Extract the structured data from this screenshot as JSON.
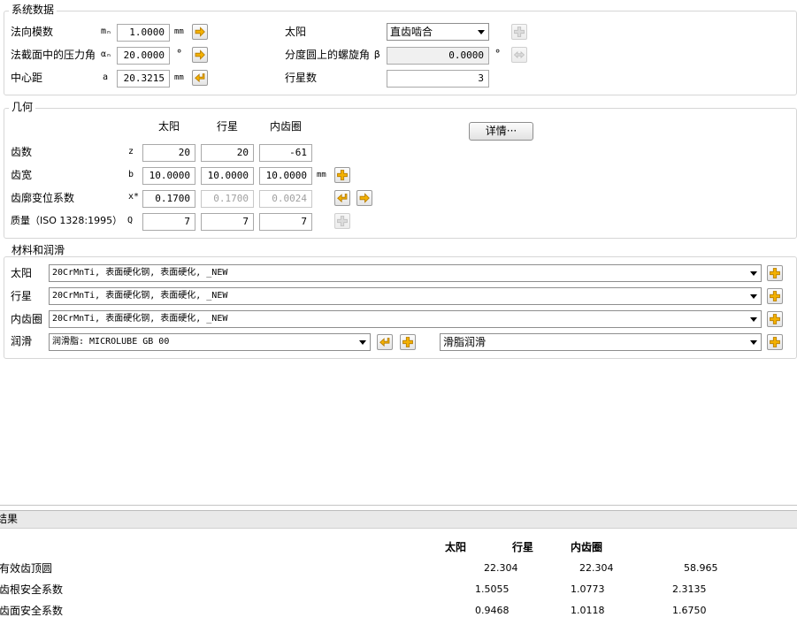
{
  "system": {
    "legend": "系统数据",
    "normal_module": {
      "label": "法向模数",
      "symbol": "mₙ",
      "value": "1.0000",
      "unit": "mm"
    },
    "pressure_angle": {
      "label": "法截面中的压力角",
      "symbol": "αₙ",
      "value": "20.0000",
      "unit": "°"
    },
    "center_distance": {
      "label": "中心距",
      "symbol": "a",
      "value": "20.3215",
      "unit": "mm"
    },
    "sun": {
      "label": "太阳",
      "value": "直齿啮合"
    },
    "helix_angle": {
      "label": "分度圆上的螺旋角",
      "symbol": "β",
      "value": "0.0000",
      "unit": "°"
    },
    "planets": {
      "label": "行星数",
      "value": "3"
    }
  },
  "geometry": {
    "legend": "几何",
    "columns": [
      "太阳",
      "行星",
      "内齿圈"
    ],
    "details_button": "详情···",
    "rows": [
      {
        "label": "齿数",
        "symbol": "z",
        "values": [
          "20",
          "20",
          "-61"
        ],
        "unit": ""
      },
      {
        "label": "齿宽",
        "symbol": "b",
        "values": [
          "10.0000",
          "10.0000",
          "10.0000"
        ],
        "unit": "mm"
      },
      {
        "label": "齿廓变位系数",
        "symbol": "x*",
        "values": [
          "0.1700",
          "0.1700",
          "0.0024"
        ],
        "unit": ""
      },
      {
        "label": "质量（ISO 1328:1995）",
        "symbol": "Q",
        "values": [
          "7",
          "7",
          "7"
        ],
        "unit": ""
      }
    ]
  },
  "materials": {
    "legend": "材料和润滑",
    "sun": {
      "label": "太阳",
      "value": "20CrMnTi, 表面硬化钢, 表面硬化, _NEW"
    },
    "planet": {
      "label": "行星",
      "value": "20CrMnTi, 表面硬化钢, 表面硬化, _NEW"
    },
    "ring": {
      "label": "内齿圈",
      "value": "20CrMnTi, 表面硬化钢, 表面硬化, _NEW"
    },
    "lubrication": {
      "label": "润滑",
      "value": "润滑脂: MICROLUBE GB 00",
      "type": "滑脂润滑"
    }
  },
  "results": {
    "title": "结果",
    "columns": [
      "太阳",
      "行星",
      "内齿圈"
    ],
    "rows": [
      {
        "label": "有效齿顶圆",
        "values": [
          "22.304",
          "22.304",
          "58.965"
        ]
      },
      {
        "label": "齿根安全系数",
        "values": [
          "1.5055",
          "1.0773",
          "2.3135"
        ]
      },
      {
        "label": "齿面安全系数",
        "values": [
          "0.9468",
          "1.0118",
          "1.6750"
        ]
      }
    ]
  },
  "icons": {
    "arrow_right": "arrow-right-icon",
    "arrow_left": "arrow-left-icon",
    "plus": "plus-icon",
    "double_arrow": "double-arrow-icon"
  },
  "colors": {
    "accent_icon": "#f3b100",
    "icon_outline": "#b37a00",
    "disabled_icon": "#c8c8c8"
  }
}
